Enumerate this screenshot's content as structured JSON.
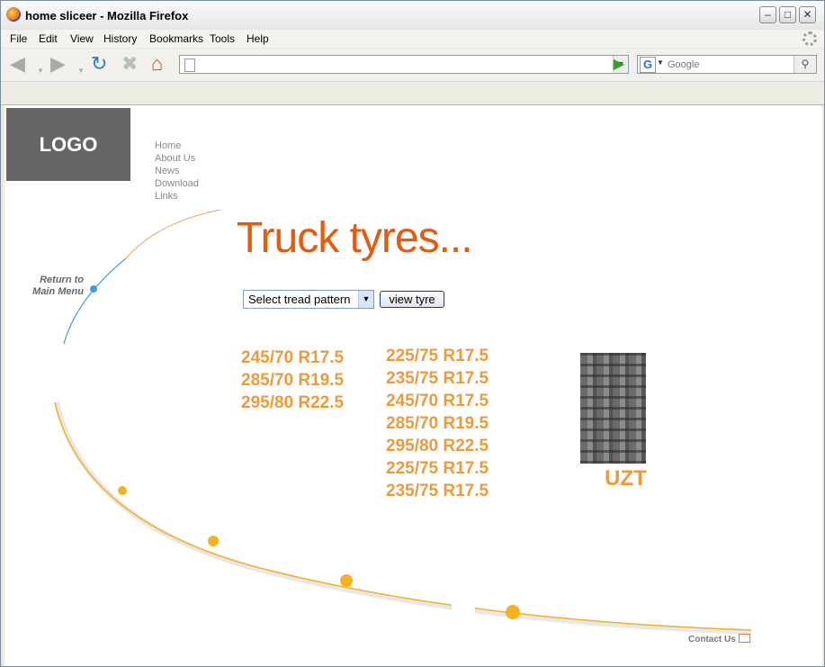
{
  "window": {
    "title": "home sliceer - Mozilla Firefox"
  },
  "menu": [
    "File",
    "Edit",
    "View",
    "History",
    "Bookmarks",
    "Tools",
    "Help"
  ],
  "navbar": {
    "url_value": "",
    "search_placeholder": "Google"
  },
  "page": {
    "logo": "LOGO",
    "nav": [
      "Home",
      "About Us",
      "News",
      "Download",
      "Links"
    ],
    "headline": "Truck tyres...",
    "return_label": [
      "Return to",
      "Main Menu"
    ],
    "select_value": "Select tread pattern",
    "view_button": "view tyre",
    "sizes_left": [
      "245/70 R17.5",
      "285/70 R19.5",
      "295/80 R22.5"
    ],
    "sizes_right": [
      "225/75 R17.5",
      "235/75 R17.5",
      "245/70 R17.5",
      "285/70 R19.5",
      "295/80 R22.5",
      "225/75 R17.5",
      "235/75 R17.5"
    ],
    "tyre_label": "UZT",
    "contact": "Contact Us"
  },
  "colors": {
    "accent_orange": "#e85a0a",
    "size_orange": "#ef9a3a",
    "arc_yellow": "#f5b21e",
    "arc_blue": "#3f9be0"
  }
}
